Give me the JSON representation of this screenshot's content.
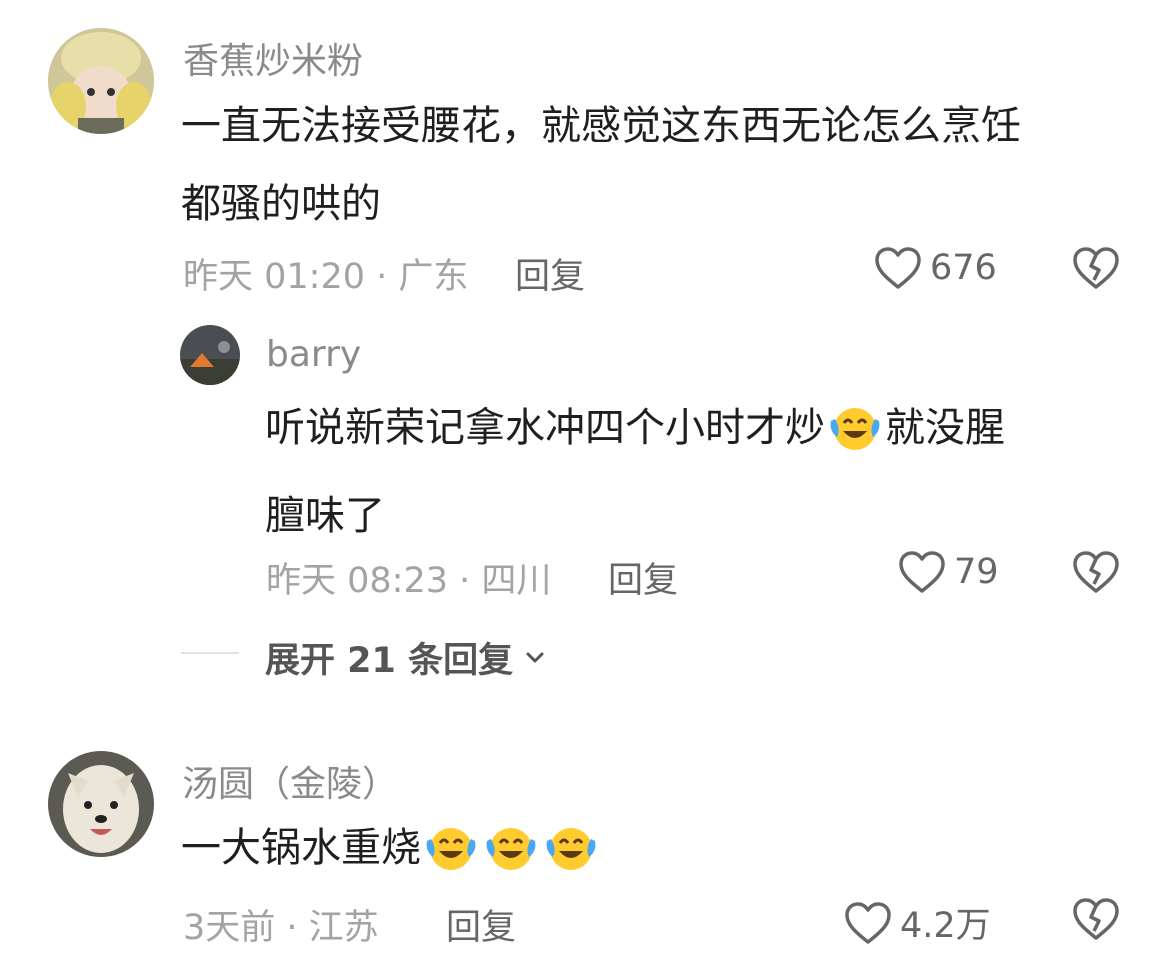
{
  "comments": [
    {
      "username": "香蕉炒米粉",
      "text_line1": "一直无法接受腰花，就感觉这东西无论怎么烹饪",
      "text_line2": "都骚的哄的",
      "meta": "昨天 01:20 · 广东",
      "reply_label": "回复",
      "likes": "676",
      "reply": {
        "username": "barry",
        "text_part1": "听说新荣记拿水冲四个小时才炒",
        "emoji": "face-with-tears-of-joy",
        "text_part2": "就没腥",
        "text_line2": "膻味了",
        "meta": "昨天 08:23 · 四川",
        "reply_label": "回复",
        "likes": "79"
      },
      "expand_label": "展开 21 条回复"
    },
    {
      "username": "汤圆（金陵）",
      "text": "一大锅水重烧",
      "emojis": [
        "face-with-tears-of-joy",
        "face-with-tears-of-joy",
        "face-with-tears-of-joy"
      ],
      "meta": "3天前 · 江苏",
      "reply_label": "回复",
      "likes": "4.2万"
    }
  ]
}
